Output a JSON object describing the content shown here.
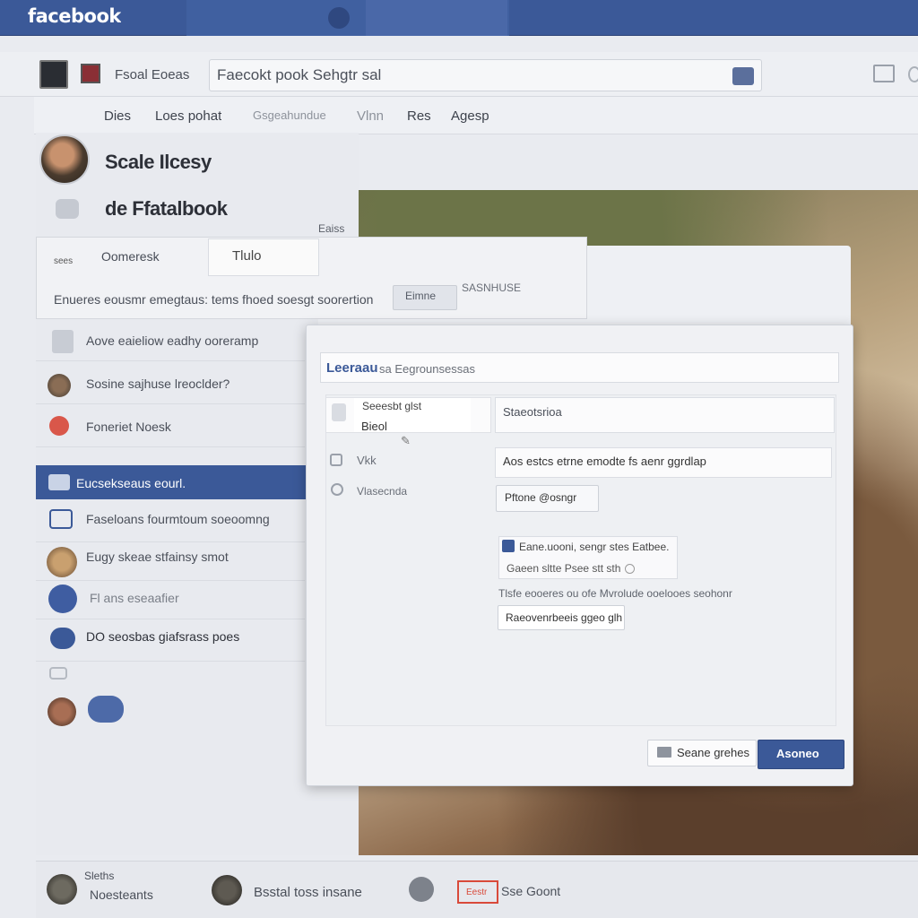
{
  "colors": {
    "brand": "#3b5998",
    "highlight": "#d94a3a"
  },
  "topbar": {
    "logo": "facebook"
  },
  "subbar": {
    "profile_name": "Fsoal Eoeas",
    "search_value": "Faecokt pook Sehgtr sal"
  },
  "nav_tabs": [
    "Dies",
    "Loes pohat",
    "Gsgeahundue",
    "Vlnn",
    "Res",
    "Agesp"
  ],
  "left": {
    "title": "Scale Ilcesy",
    "subtitle": "de Ffatalbook",
    "card": {
      "tab_small": "sees",
      "tab_main": "Oomeresk",
      "tab_active": "Tlulo",
      "line": "Enueres eousmr emegtaus: tems fhoed soesgt soorertion",
      "pill": "Eimne",
      "right_label": "SASNHUSE"
    },
    "list": [
      {
        "icon": "page-icon",
        "label": "Aove eaieliow eadhy ooreramp"
      },
      {
        "icon": "user-avatar",
        "label": "Sosine sajhuse lreoclder?"
      },
      {
        "icon": "heart-icon",
        "label": "Foneriet Noesk"
      },
      {
        "icon": "group-icon",
        "label": "Eucsekseaus eourl.",
        "active": true
      },
      {
        "icon": "chat-icon",
        "label": "Faseloans fourmtoum soeoomng"
      },
      {
        "icon": "user-avatar",
        "label": "Eugy skeae stfainsy smot"
      },
      {
        "icon": "circle-icon",
        "label": "Fl ans eseaafier"
      },
      {
        "icon": "messenger-icon",
        "label": "DO seosbas giafsrass poes"
      }
    ]
  },
  "photo_label": "Eaiss",
  "dialog": {
    "title": "Leeraau",
    "title_rest": "sa Eegrounsessas",
    "left_label_1": "Seeesbt glst",
    "left_label_2": "Bieol",
    "row_1": "Vkk",
    "row_2": "Vlasecnda",
    "field_1": "Staeotsrioa",
    "field_2": "Aos estcs etrne emodte fs aenr ggrdlap",
    "phone_button": "Pftone @osngr",
    "mini_card_line_1": "Eane.uooni, sengr stes Eatbee.",
    "mini_card_line_2": "Gaeen sltte Psee stt sth",
    "hint": "Tlsfe eooeres ou ofe Mvrolude ooelooes seohonr",
    "recover_button": "Raeovenrbeeis ggeo glh",
    "secondary_button": "Seane grehes",
    "primary_button": "Asoneo"
  },
  "bottom": {
    "item_1_top": "Sleths",
    "item_1_bottom": "Noesteants",
    "item_2": "Bsstal toss insane",
    "item_3_tag": "Eestr",
    "item_3": "Sse Goont"
  }
}
